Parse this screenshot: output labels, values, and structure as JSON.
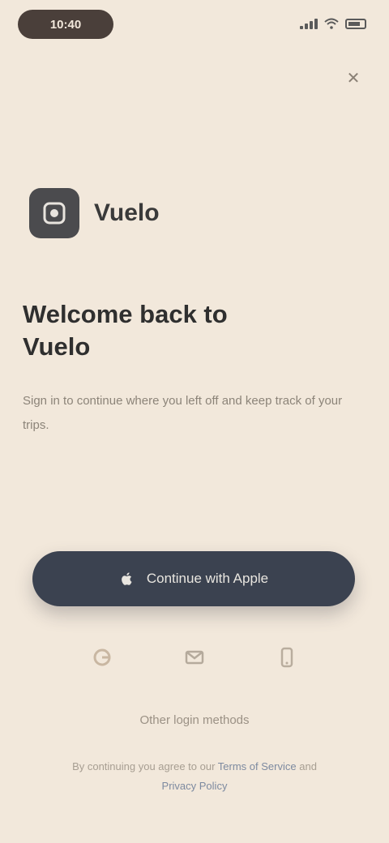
{
  "status_bar": {
    "time": "10:40"
  },
  "close": {
    "label": "✕"
  },
  "brand": {
    "name": "Vuelo",
    "logo_icon": "app-logo-icon"
  },
  "headline": "Welcome back to Vuelo",
  "subtext": "Sign in to continue where you left off and keep track of your trips.",
  "primary_button": {
    "label": "Continue with Apple",
    "icon": "apple-icon"
  },
  "alternative_logins": [
    {
      "name": "google",
      "icon": "google-icon"
    },
    {
      "name": "email",
      "icon": "email-icon"
    },
    {
      "name": "phone",
      "icon": "phone-icon"
    }
  ],
  "other_login_link": "Other login methods",
  "agreement": {
    "prefix": "By continuing you agree to our",
    "terms": "Terms of Service",
    "conjunction": "and",
    "privacy": "Privacy Policy"
  },
  "colors": {
    "background": "#f2e8db",
    "primary_button": "#3b4250",
    "logo_bg": "#4b4b4e"
  }
}
